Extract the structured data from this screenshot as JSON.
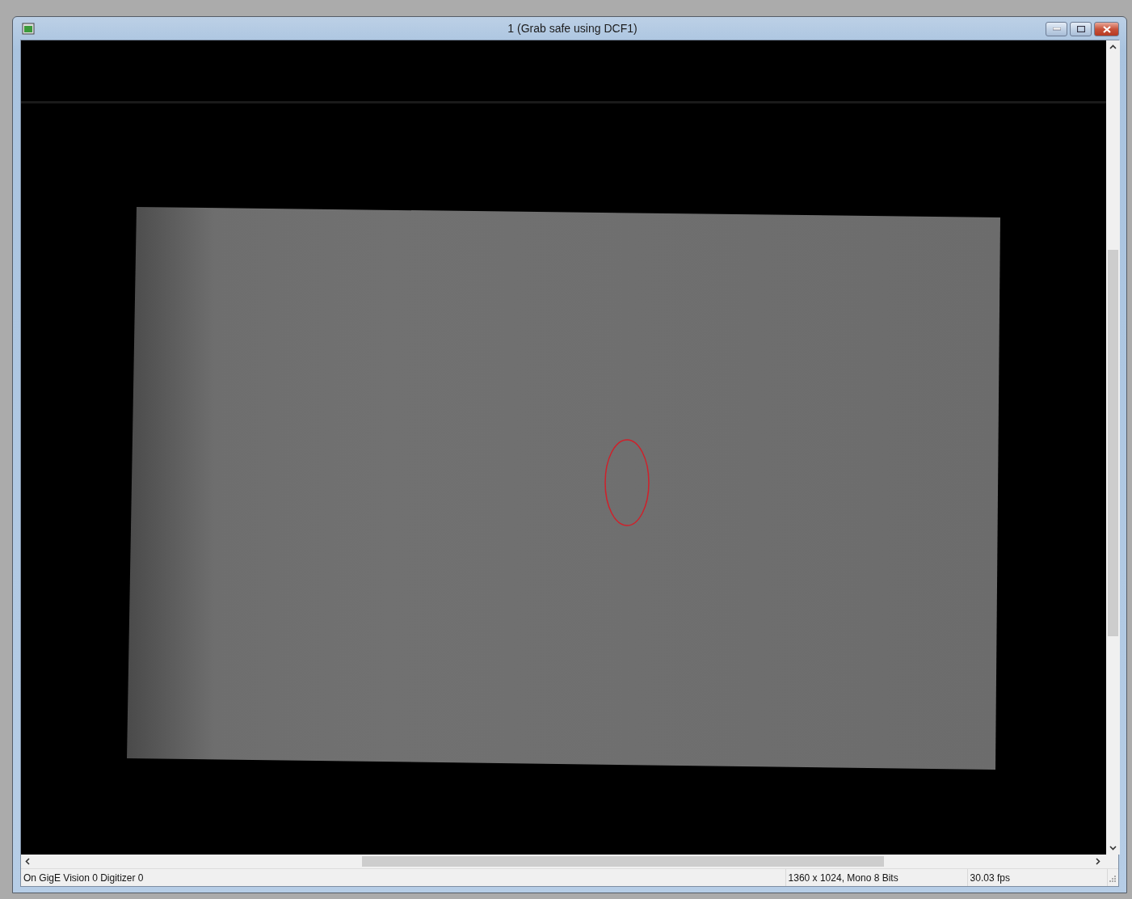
{
  "window": {
    "title": "1 (Grab safe using DCF1)"
  },
  "status_bar": [
    {
      "text": "On GigE Vision 0 Digitizer 0"
    },
    {
      "text": "1360 x 1024, Mono 8 Bits"
    },
    {
      "text": "30.03 fps"
    }
  ]
}
